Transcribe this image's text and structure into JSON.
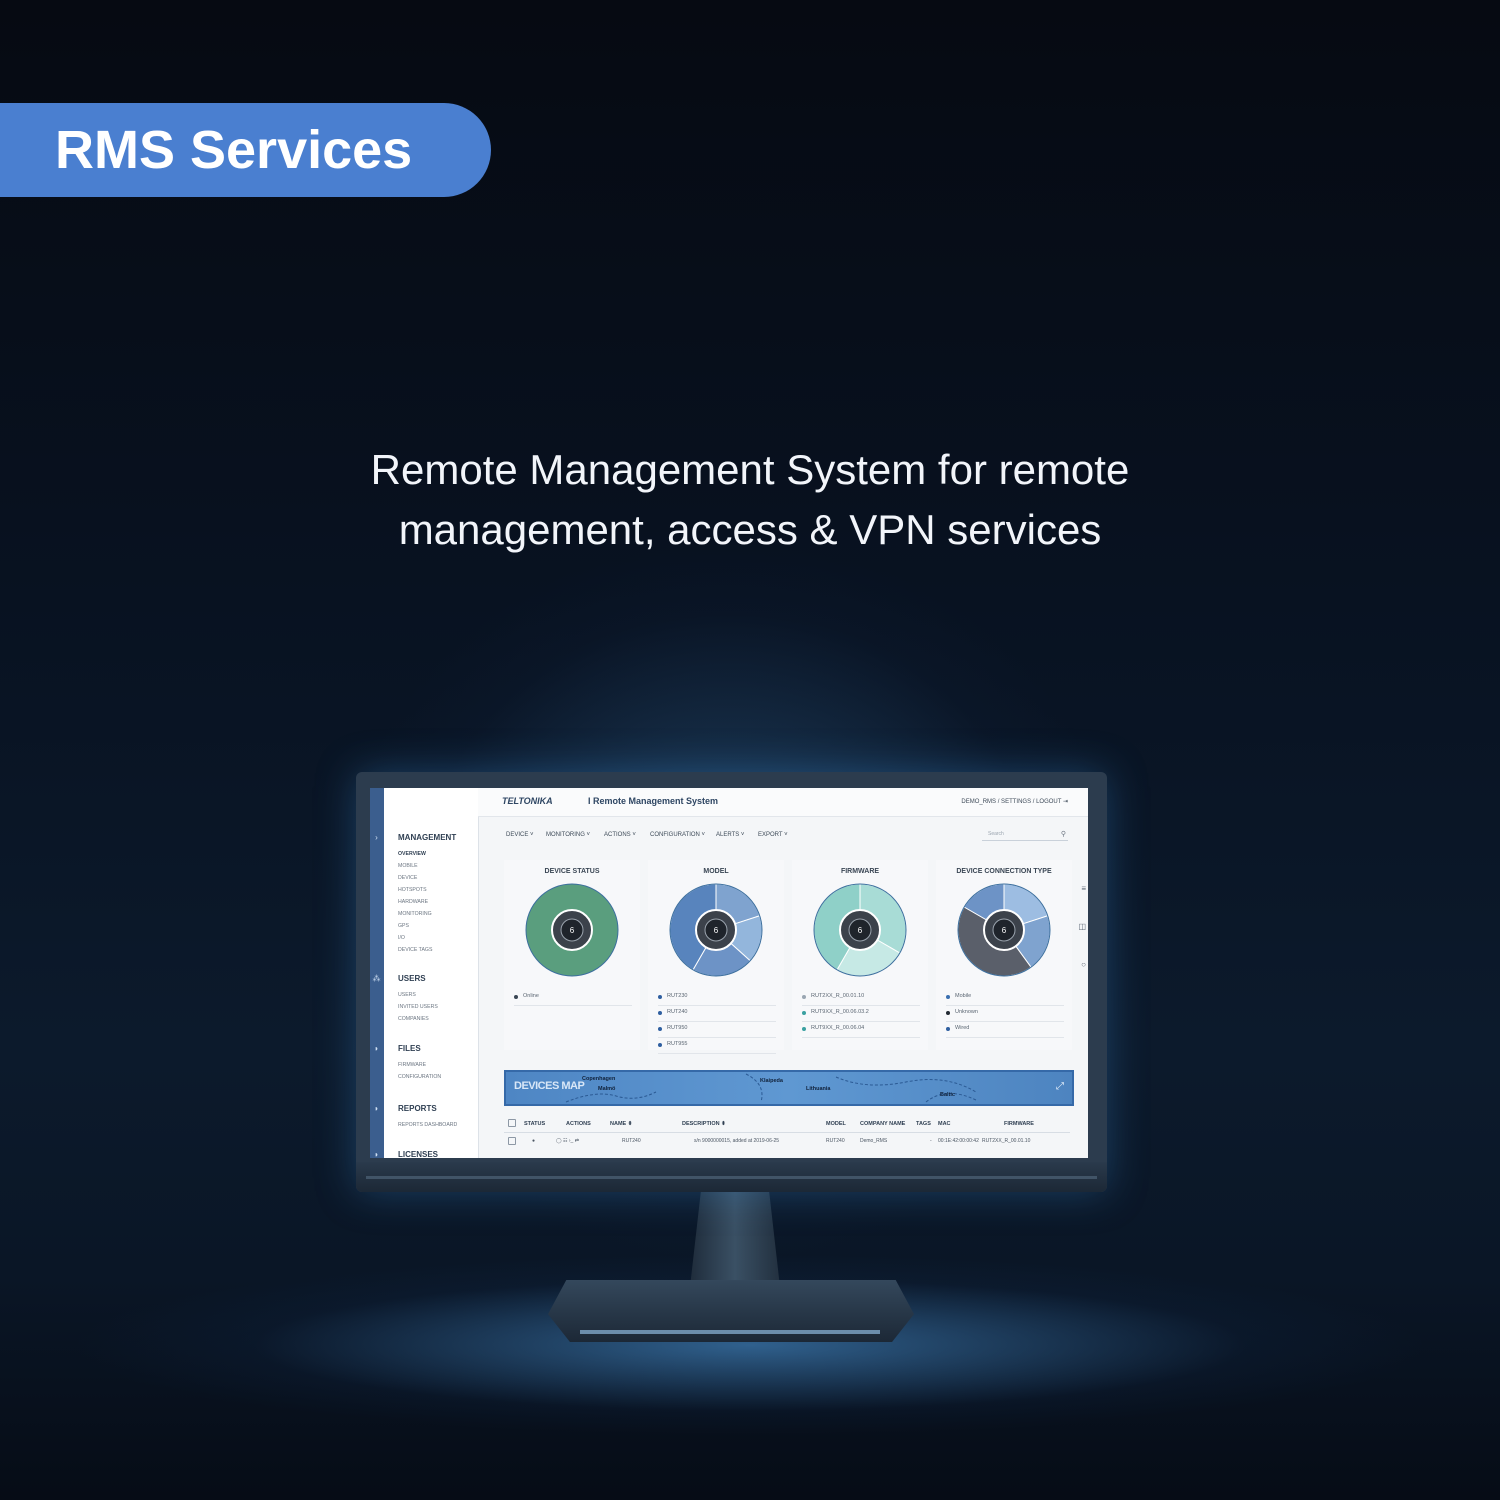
{
  "banner": {
    "title": "RMS Services"
  },
  "tagline": {
    "line1": "Remote Management System for remote",
    "line2": "management, access & VPN services"
  },
  "app": {
    "logo": "TELTONIKA",
    "brand_rest": "I Remote Management System",
    "user_links": "DEMO_RMS  /  SETTINGS  /  LOGOUT ⇥",
    "menu": [
      "DEVICE ˅",
      "MONITORING ˅",
      "ACTIONS ˅",
      "CONFIGURATION ˅",
      "ALERTS ˅",
      "EXPORT ˅"
    ],
    "search_placeholder": "Search",
    "sidebar": {
      "management": {
        "title": "MANAGEMENT",
        "items": [
          "OVERVIEW",
          "MOBILE",
          "DEVICE",
          "HOTSPOTS",
          "HARDWARE",
          "MONITORING",
          "GPS",
          "I/O",
          "DEVICE TAGS"
        ]
      },
      "users": {
        "title": "USERS",
        "items": [
          "USERS",
          "INVITED USERS",
          "COMPANIES"
        ]
      },
      "files": {
        "title": "FILES",
        "items": [
          "FIRMWARE",
          "CONFIGURATION"
        ]
      },
      "reports": {
        "title": "REPORTS",
        "items": [
          "REPORTS DASHBOARD"
        ]
      },
      "licenses": {
        "title": "LICENSES"
      }
    },
    "cards": [
      {
        "title": "DEVICE STATUS",
        "center": "6",
        "legend": [
          {
            "label": "Online",
            "color": "#3a4654"
          }
        ],
        "slices": [
          {
            "value": 6,
            "color": "#5a9e7e"
          }
        ]
      },
      {
        "title": "MODEL",
        "center": "6",
        "legend": [
          {
            "label": "RUT230",
            "color": "#2f5fa0"
          },
          {
            "label": "RUT240",
            "color": "#2f5fa0"
          },
          {
            "label": "RUT950",
            "color": "#2f5fa0"
          },
          {
            "label": "RUT955",
            "color": "#2f5fa0"
          }
        ],
        "slices": [
          {
            "value": 1.2,
            "color": "#7fa3cf"
          },
          {
            "value": 1.0,
            "color": "#93b6dc"
          },
          {
            "value": 1.3,
            "color": "#6d93c6"
          },
          {
            "value": 2.5,
            "color": "#5884bd"
          }
        ]
      },
      {
        "title": "FIRMWARE",
        "center": "6",
        "legend": [
          {
            "label": "RUT2XX_R_00.01.10",
            "color": "#9aa6b2"
          },
          {
            "label": "RUT9XX_R_00.06.03.2",
            "color": "#3aa0a0"
          },
          {
            "label": "RUT9XX_R_00.06.04",
            "color": "#3aa0a0"
          }
        ],
        "slices": [
          {
            "value": 2.0,
            "color": "#a8dcd6"
          },
          {
            "value": 1.5,
            "color": "#c6e9e5"
          },
          {
            "value": 2.5,
            "color": "#8fd0c8"
          }
        ]
      },
      {
        "title": "DEVICE CONNECTION TYPE",
        "center": "6",
        "legend": [
          {
            "label": "Mobile",
            "color": "#3a6fb0"
          },
          {
            "label": "Unknown",
            "color": "#222a33"
          },
          {
            "label": "Wired",
            "color": "#2f5fa0"
          }
        ],
        "slices": [
          {
            "value": 1.2,
            "color": "#9dbde2"
          },
          {
            "value": 1.2,
            "color": "#7fa3cf"
          },
          {
            "value": 2.6,
            "color": "#5a5f6a"
          },
          {
            "value": 1.0,
            "color": "#6d93c6"
          }
        ]
      }
    ],
    "map": {
      "title": "DEVICES MAP",
      "labels": [
        "Copenhagen",
        "Malmö",
        "Klaipeda",
        "Lithuania",
        "Baltic"
      ]
    },
    "table": {
      "headers": [
        "STATUS",
        "ACTIONS",
        "NAME ⬍",
        "DESCRIPTION ⬍",
        "MODEL",
        "COMPANY NAME",
        "TAGS",
        "MAC",
        "FIRMWARE"
      ],
      "rows": [
        {
          "status": "●",
          "actions": "◯ ☷ ›_ ⇄",
          "name": "RUT240",
          "description": "s/n 9000000015, added at 2019-06-25",
          "model": "RUT240",
          "company": "Demo_RMS",
          "tags": "-",
          "mac": "00:1E:42:00:00:42",
          "firmware": "RUT2XX_R_00.01.10"
        }
      ]
    }
  }
}
